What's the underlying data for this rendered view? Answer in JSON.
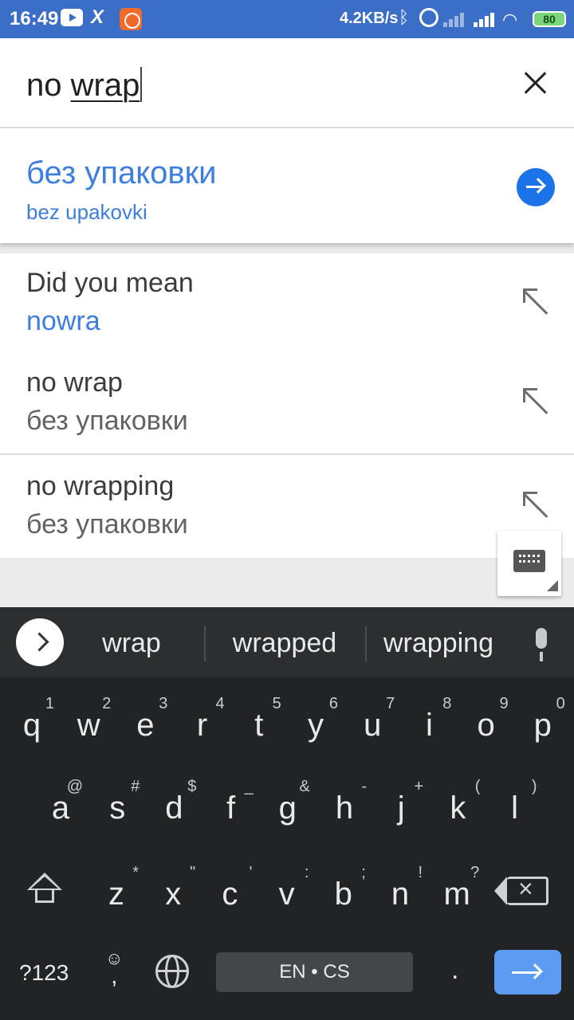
{
  "status_bar": {
    "time": "16:49",
    "network_speed": "4.2KB/s",
    "battery": "80",
    "icons": [
      "youtube-icon",
      "x-app-icon",
      "orange-app-icon",
      "bluetooth-icon",
      "alarm-icon",
      "signal-icon",
      "signal-icon",
      "wifi-icon",
      "battery-icon"
    ]
  },
  "search": {
    "query_prefix": "no ",
    "query_underlined": "wrap"
  },
  "translation": {
    "text": "без упаковки",
    "transliteration": "bez upakovki"
  },
  "suggestions": [
    {
      "line1": "Did you mean",
      "line2": "nowra"
    },
    {
      "line1": "no wrap",
      "line2": "без упаковки"
    },
    {
      "line1": "no wrapping",
      "line2": "без упаковки"
    }
  ],
  "keyboard": {
    "suggestions": [
      "wrap",
      "wrapped",
      "wrapping"
    ],
    "row1": [
      {
        "ch": "q",
        "hint": "1"
      },
      {
        "ch": "w",
        "hint": "2"
      },
      {
        "ch": "e",
        "hint": "3"
      },
      {
        "ch": "r",
        "hint": "4"
      },
      {
        "ch": "t",
        "hint": "5"
      },
      {
        "ch": "y",
        "hint": "6"
      },
      {
        "ch": "u",
        "hint": "7"
      },
      {
        "ch": "i",
        "hint": "8"
      },
      {
        "ch": "o",
        "hint": "9"
      },
      {
        "ch": "p",
        "hint": "0"
      }
    ],
    "row2": [
      {
        "ch": "a",
        "hint": "@"
      },
      {
        "ch": "s",
        "hint": "#"
      },
      {
        "ch": "d",
        "hint": "$"
      },
      {
        "ch": "f",
        "hint": "_"
      },
      {
        "ch": "g",
        "hint": "&"
      },
      {
        "ch": "h",
        "hint": "-"
      },
      {
        "ch": "j",
        "hint": "+"
      },
      {
        "ch": "k",
        "hint": "("
      },
      {
        "ch": "l",
        "hint": ")"
      }
    ],
    "row3": [
      {
        "ch": "z",
        "hint": "*"
      },
      {
        "ch": "x",
        "hint": "\""
      },
      {
        "ch": "c",
        "hint": "'"
      },
      {
        "ch": "v",
        "hint": ":"
      },
      {
        "ch": "b",
        "hint": ";"
      },
      {
        "ch": "n",
        "hint": "!"
      },
      {
        "ch": "m",
        "hint": "?"
      }
    ],
    "symbols_label": "?123",
    "emoji_label": "☺",
    "comma_label": ",",
    "space_label": "EN • CS",
    "period_label": "."
  },
  "colors": {
    "status_bar": "#3b6fc7",
    "accent_blue": "#1a73e8",
    "keyboard_bg": "#212426"
  }
}
